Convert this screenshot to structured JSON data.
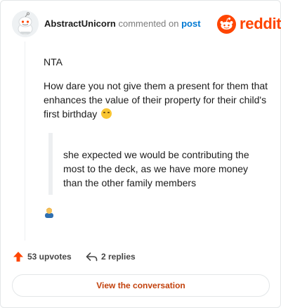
{
  "header": {
    "username": "AbstractUnicorn",
    "commented_text": "commented on",
    "post_link": "post",
    "brand": "reddit"
  },
  "comment": {
    "paragraph1": "NTA",
    "paragraph2": "How dare you not give them a present for them that enhances the value of their property for their child's first birthday",
    "quote": "she expected we would be contributing the most to the deck, as we have more money than the other family members"
  },
  "footer": {
    "upvotes": "53 upvotes",
    "replies": "2 replies",
    "view_button": "View the conversation"
  },
  "icons": {
    "avatar": "snoo-avatar-icon",
    "brand_logo": "reddit-logo-icon",
    "upvote": "upvote-arrow-icon",
    "reply": "reply-arrow-icon",
    "emoji1": "zany-face-emoji",
    "emoji2": "person-emoji"
  },
  "colors": {
    "brand": "#ff4500",
    "link": "#0079d3",
    "button_text": "#c2410c"
  }
}
